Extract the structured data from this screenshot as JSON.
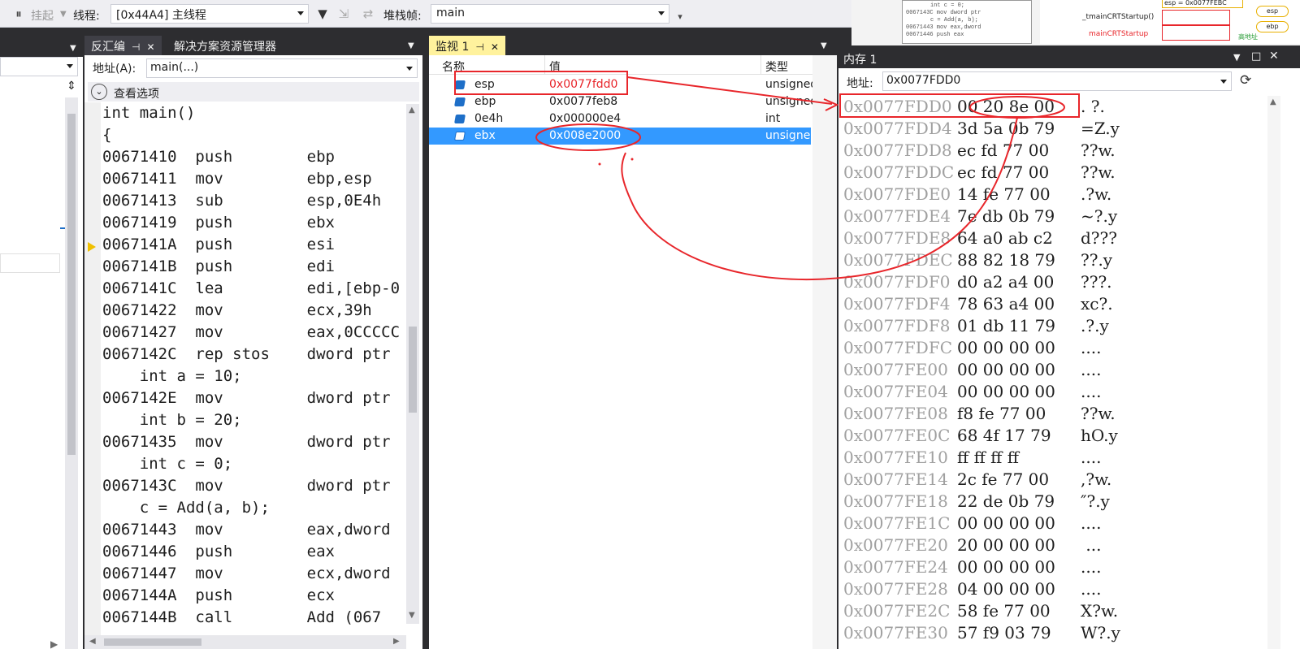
{
  "toolbar": {
    "suspend_label": "挂起",
    "thread_label": "线程:",
    "thread_value": "[0x44A4] 主线程",
    "stackframe_label": "堆栈帧:",
    "stackframe_value": "main"
  },
  "disasm": {
    "tab_label": "反汇编",
    "solution_tab_label": "解决方案资源管理器",
    "address_label": "地址(A):",
    "address_value": "main(...)",
    "view_options_label": "查看选项",
    "lines": [
      "int main()",
      "{",
      "00671410  push        ebp",
      "00671411  mov         ebp,esp",
      "00671413  sub         esp,0E4h",
      "00671419  push        ebx",
      "0067141A  push        esi",
      "0067141B  push        edi",
      "0067141C  lea         edi,[ebp-0",
      "00671422  mov         ecx,39h",
      "00671427  mov         eax,0CCCCC",
      "0067142C  rep stos    dword ptr",
      "    int a = 10;",
      "0067142E  mov         dword ptr",
      "    int b = 20;",
      "00671435  mov         dword ptr",
      "    int c = 0;",
      "0067143C  mov         dword ptr",
      "    c = Add(a, b);",
      "00671443  mov         eax,dword",
      "00671446  push        eax",
      "00671447  mov         ecx,dword",
      "0067144A  push        ecx",
      "0067144B  call        Add (067"
    ]
  },
  "watch": {
    "tab_label": "监视 1",
    "headers": {
      "name": "名称",
      "value": "值",
      "type": "类型"
    },
    "rows": [
      {
        "name": "esp",
        "value": "0x0077fdd0",
        "type": "unsigned",
        "changed": true
      },
      {
        "name": "ebp",
        "value": "0x0077feb8",
        "type": "unsigned",
        "changed": false
      },
      {
        "name": "0e4h",
        "value": "0x000000e4",
        "type": "int",
        "changed": false
      },
      {
        "name": "ebx",
        "value": "0x008e2000",
        "type": "unsigned",
        "changed": false
      }
    ]
  },
  "memory": {
    "title": "内存 1",
    "address_label": "地址:",
    "address_value": "0x0077FDD0",
    "rows": [
      {
        "addr": "0x0077FDD0",
        "bytes": "00 20 8e 00",
        "ascii": ". ?."
      },
      {
        "addr": "0x0077FDD4",
        "bytes": "3d 5a 0b 79",
        "ascii": "=Z.y"
      },
      {
        "addr": "0x0077FDD8",
        "bytes": "ec fd 77 00",
        "ascii": "??w."
      },
      {
        "addr": "0x0077FDDC",
        "bytes": "ec fd 77 00",
        "ascii": "??w."
      },
      {
        "addr": "0x0077FDE0",
        "bytes": "14 fe 77 00",
        "ascii": ".?w."
      },
      {
        "addr": "0x0077FDE4",
        "bytes": "7e db 0b 79",
        "ascii": "~?.y"
      },
      {
        "addr": "0x0077FDE8",
        "bytes": "64 a0 ab c2",
        "ascii": "d???"
      },
      {
        "addr": "0x0077FDEC",
        "bytes": "88 82 18 79",
        "ascii": "??.y"
      },
      {
        "addr": "0x0077FDF0",
        "bytes": "d0 a2 a4 00",
        "ascii": "???."
      },
      {
        "addr": "0x0077FDF4",
        "bytes": "78 63 a4 00",
        "ascii": "xc?."
      },
      {
        "addr": "0x0077FDF8",
        "bytes": "01 db 11 79",
        "ascii": ".?.y"
      },
      {
        "addr": "0x0077FDFC",
        "bytes": "00 00 00 00",
        "ascii": "...."
      },
      {
        "addr": "0x0077FE00",
        "bytes": "00 00 00 00",
        "ascii": "...."
      },
      {
        "addr": "0x0077FE04",
        "bytes": "00 00 00 00",
        "ascii": "...."
      },
      {
        "addr": "0x0077FE08",
        "bytes": "f8 fe 77 00",
        "ascii": "??w."
      },
      {
        "addr": "0x0077FE0C",
        "bytes": "68 4f 17 79",
        "ascii": "hO.y"
      },
      {
        "addr": "0x0077FE10",
        "bytes": "ff ff ff ff",
        "ascii": "...."
      },
      {
        "addr": "0x0077FE14",
        "bytes": "2c fe 77 00",
        "ascii": ",?w."
      },
      {
        "addr": "0x0077FE18",
        "bytes": "22 de 0b 79",
        "ascii": "″?.y"
      },
      {
        "addr": "0x0077FE1C",
        "bytes": "00 00 00 00",
        "ascii": "...."
      },
      {
        "addr": "0x0077FE20",
        "bytes": "20 00 00 00",
        "ascii": " ..."
      },
      {
        "addr": "0x0077FE24",
        "bytes": "00 00 00 00",
        "ascii": "...."
      },
      {
        "addr": "0x0077FE28",
        "bytes": "04 00 00 00",
        "ascii": "...."
      },
      {
        "addr": "0x0077FE2C",
        "bytes": "58 fe 77 00",
        "ascii": "X?w."
      },
      {
        "addr": "0x0077FE30",
        "bytes": "57 f9 03 79",
        "ascii": "W?.y"
      }
    ]
  },
  "diagram_thumb": {
    "esp_note": "esp = 0x0077FEBC",
    "startup_label": "_tmainCRTStartup()",
    "startup_label_red": "mainCRTStartup",
    "high_addr_label": "高地址",
    "esp_tag": "esp",
    "ebp_tag": "ebp",
    "code_lines": [
      "int c = 0;",
      "0067143C  mov        dword ptr",
      "c = Add(a, b);",
      "00671443  mov        eax,dword",
      "00671446  push       eax"
    ]
  }
}
